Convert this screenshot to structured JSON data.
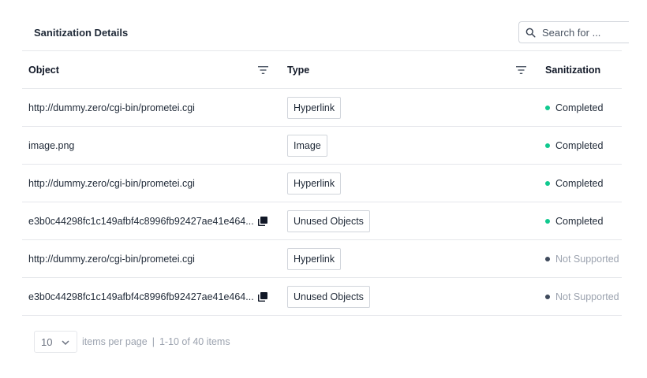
{
  "header": {
    "title": "Sanitization Details",
    "search_placeholder": "Search for ..."
  },
  "columns": {
    "object": "Object",
    "type": "Type",
    "sanitization": "Sanitization"
  },
  "rows": [
    {
      "object": "http://dummy.zero/cgi-bin/prometei.cgi",
      "copy": false,
      "type": "Hyperlink",
      "status": "Completed",
      "status_kind": "completed"
    },
    {
      "object": "image.png",
      "copy": false,
      "type": "Image",
      "status": "Completed",
      "status_kind": "completed"
    },
    {
      "object": "http://dummy.zero/cgi-bin/prometei.cgi",
      "copy": false,
      "type": "Hyperlink",
      "status": "Completed",
      "status_kind": "completed"
    },
    {
      "object": "e3b0c44298fc1c149afbf4c8996fb92427ae41e464...",
      "copy": true,
      "type": "Unused Objects",
      "status": "Completed",
      "status_kind": "completed"
    },
    {
      "object": "http://dummy.zero/cgi-bin/prometei.cgi",
      "copy": false,
      "type": "Hyperlink",
      "status": "Not Supported",
      "status_kind": "unsupported"
    },
    {
      "object": "e3b0c44298fc1c149afbf4c8996fb92427ae41e464...",
      "copy": true,
      "type": "Unused Objects",
      "status": "Not Supported",
      "status_kind": "unsupported"
    }
  ],
  "pagination": {
    "page_size": "10",
    "items_per_page_label": "items per page",
    "separator": "|",
    "range": "1-10 of 40 items"
  },
  "colors": {
    "completed": "#10c98f",
    "unsupported": "#3f4a5c",
    "muted_text": "#9ca3af",
    "border": "#e5e7eb"
  },
  "icons": {
    "search": "search-icon",
    "filter": "filter-icon",
    "copy": "copy-icon",
    "dropdown": "chevron-down-icon"
  }
}
